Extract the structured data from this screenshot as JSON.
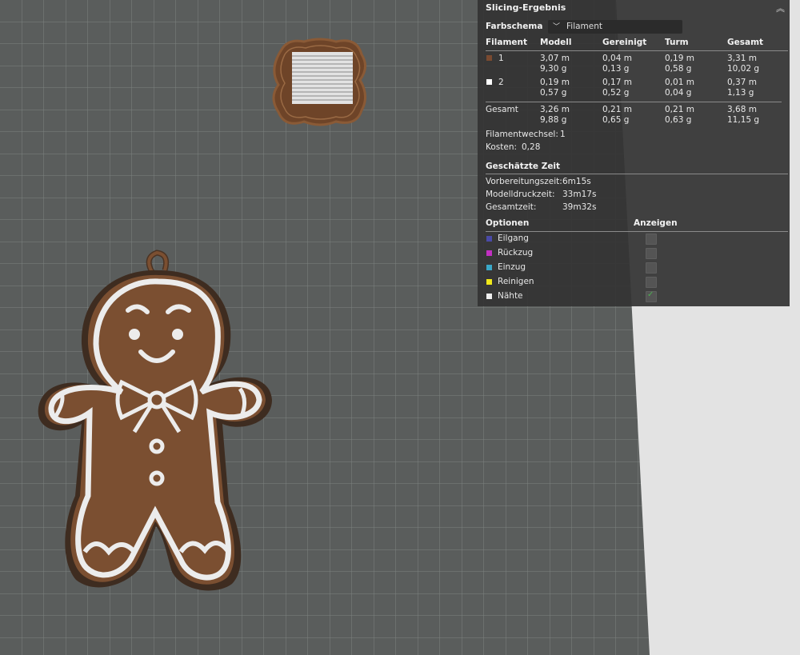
{
  "panel": {
    "title": "Slicing-Ergebnis",
    "color_scheme_label": "Farbschema",
    "color_scheme_value": "Filament",
    "headers": [
      "Filament",
      "Modell",
      "Gereinigt",
      "Turm",
      "Gesamt"
    ],
    "filaments": [
      {
        "id": "1",
        "color": "#7a4a30",
        "model_m": "3,07 m",
        "model_g": "9,30 g",
        "purged_m": "0,04 m",
        "purged_g": "0,13 g",
        "tower_m": "0,19 m",
        "tower_g": "0,58 g",
        "total_m": "3,31 m",
        "total_g": "10,02 g"
      },
      {
        "id": "2",
        "color": "#ffffff",
        "model_m": "0,19 m",
        "model_g": "0,57 g",
        "purged_m": "0,17 m",
        "purged_g": "0,52 g",
        "tower_m": "0,01 m",
        "tower_g": "0,04 g",
        "total_m": "0,37 m",
        "total_g": "1,13 g"
      }
    ],
    "total": {
      "label": "Gesamt",
      "model_m": "3,26 m",
      "model_g": "9,88 g",
      "purged_m": "0,21 m",
      "purged_g": "0,65 g",
      "tower_m": "0,21 m",
      "tower_g": "0,63 g",
      "total_m": "3,68 m",
      "total_g": "11,15 g"
    },
    "changes_label": "Filamentwechsel:",
    "changes_value": "1",
    "cost_label": "Kosten:",
    "cost_value": "0,28",
    "time_heading": "Geschätzte Zeit",
    "times": [
      {
        "label": "Vorbereitungszeit:",
        "value": "6m15s"
      },
      {
        "label": "Modelldruckzeit:",
        "value": "33m17s"
      },
      {
        "label": "Gesamtzeit:",
        "value": "39m32s"
      }
    ],
    "options_heading": "Optionen",
    "show_heading": "Anzeigen",
    "options": [
      {
        "label": "Eilgang",
        "color": "#4a4aa8",
        "checked": false
      },
      {
        "label": "Rückzug",
        "color": "#c22fc2",
        "checked": false
      },
      {
        "label": "Einzug",
        "color": "#3aa8c8",
        "checked": false
      },
      {
        "label": "Reinigen",
        "color": "#f0e81a",
        "checked": false
      },
      {
        "label": "Nähte",
        "color": "#eeeeee",
        "checked": true
      }
    ]
  },
  "icons": {
    "collapse": "double-chevron-up-icon",
    "dropdown": "chevron-down-icon"
  },
  "colors": {
    "plate": "#5a5d5c",
    "grid": "#7d8281",
    "brown": "#7b4f31",
    "white_filament": "#ececec"
  }
}
